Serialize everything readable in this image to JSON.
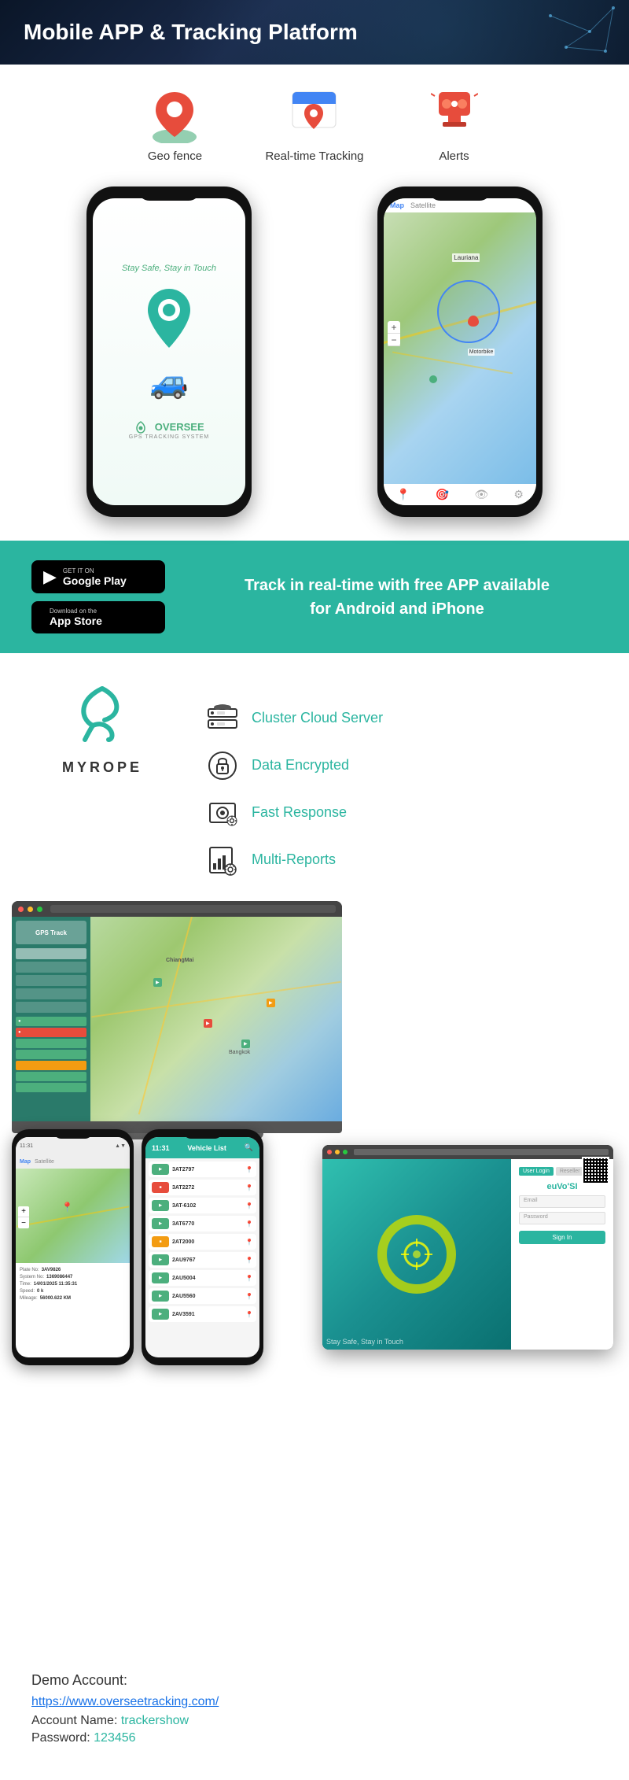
{
  "header": {
    "title": "Mobile APP & Tracking Platform"
  },
  "features": {
    "items": [
      {
        "label": "Geo fence",
        "icon": "geo-fence-icon"
      },
      {
        "label": "Real-time Tracking",
        "icon": "map-pin-icon"
      },
      {
        "label": "Alerts",
        "icon": "alert-icon"
      }
    ]
  },
  "phone_left": {
    "tagline": "Stay Safe, Stay in Touch",
    "logo": "OVERSEE",
    "logo_sub": "GPS TRACKING SYSTEM"
  },
  "appstore": {
    "google_play_small": "GET IT ON",
    "google_play_large": "Google Play",
    "app_store_small": "Download on the",
    "app_store_large": "App Store",
    "tagline_line1": "Track in real-time with free APP available",
    "tagline_line2": "for Android and iPhone"
  },
  "brand": {
    "name": "MYROPE"
  },
  "server_features": [
    {
      "label": "Cluster Cloud Server",
      "icon": "cloud-server-icon"
    },
    {
      "label": "Data Encrypted",
      "icon": "lock-icon"
    },
    {
      "label": "Fast Response",
      "icon": "speed-icon"
    },
    {
      "label": "Multi-Reports",
      "icon": "report-icon"
    }
  ],
  "map_tabs": {
    "active": "Map",
    "inactive": "Satellite"
  },
  "vehicle_list": {
    "title": "Vehicle List",
    "time": "11:31",
    "items": [
      {
        "id": "3AT2797",
        "color": "#4caf7d"
      },
      {
        "id": "3AT2272",
        "color": "#e74c3c"
      },
      {
        "id": "3AT-6102",
        "color": "#4caf7d"
      },
      {
        "id": "3AT6770",
        "color": "#4caf7d"
      },
      {
        "id": "2AT2000",
        "color": "#f39c12"
      },
      {
        "id": "2AU9767",
        "color": "#4caf7d"
      },
      {
        "id": "2AU5004",
        "color": "#4caf7d"
      },
      {
        "id": "2AU5560",
        "color": "#4caf7d"
      },
      {
        "id": "2AV3591",
        "color": "#4caf7d"
      }
    ]
  },
  "login_screen": {
    "tabs": [
      "User Login",
      "Reseller Login"
    ],
    "logo": "euVo'SI",
    "tagline": "Stay Safe, Stay in Touch",
    "username_placeholder": "Email",
    "password_placeholder": "Password",
    "submit_label": "Sign In"
  },
  "demo": {
    "title": "Demo Account:",
    "link": "https://www.overseetracking.com/",
    "account_label": "Account Name:",
    "account_value": "trackershow",
    "password_label": "Password:",
    "password_value": "123456"
  },
  "platform": {
    "time": "11:31"
  }
}
